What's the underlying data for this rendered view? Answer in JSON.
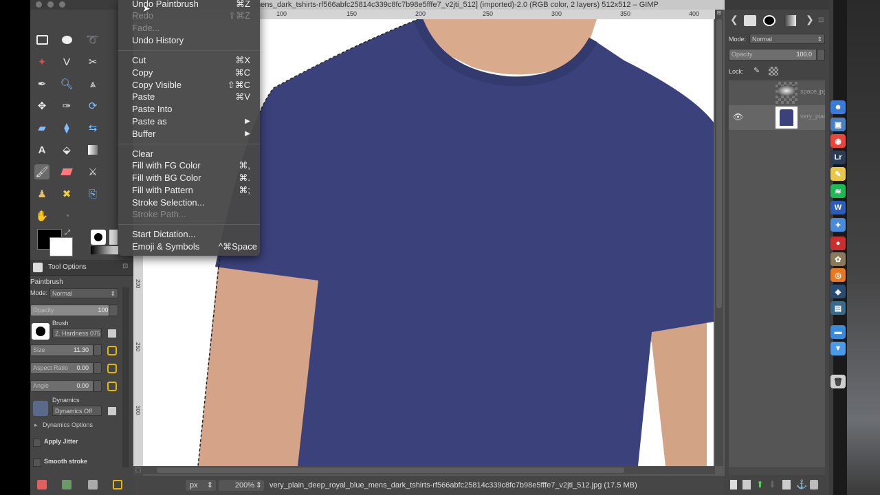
{
  "window": {
    "title": "mens_dark_tshirts-rf566abfc25814c339c8fc7b98e5fffe7_v2jti_512] (imported)-2.0 (RGB color, 2 layers) 512x512 – GIMP"
  },
  "ruler": {
    "h_ticks": [
      "100",
      "150",
      "200",
      "250",
      "300",
      "350",
      "400"
    ],
    "v_ticks": [
      "200",
      "250",
      "300"
    ]
  },
  "edit_menu": {
    "items": [
      {
        "label": "Undo Paintbrush",
        "shortcut": "⌘Z",
        "enabled": true
      },
      {
        "label": "Redo",
        "shortcut": "⇧⌘Z",
        "enabled": false
      },
      {
        "label": "Fade...",
        "shortcut": "",
        "enabled": false
      },
      {
        "label": "Undo History",
        "shortcut": "",
        "enabled": true
      },
      {
        "label": "Cut",
        "shortcut": "⌘X",
        "enabled": true
      },
      {
        "label": "Copy",
        "shortcut": "⌘C",
        "enabled": true
      },
      {
        "label": "Copy Visible",
        "shortcut": "⇧⌘C",
        "enabled": true
      },
      {
        "label": "Paste",
        "shortcut": "⌘V",
        "enabled": true
      },
      {
        "label": "Paste Into",
        "shortcut": "",
        "enabled": true
      },
      {
        "label": "Paste as",
        "shortcut": "▶",
        "enabled": true
      },
      {
        "label": "Buffer",
        "shortcut": "▶",
        "enabled": true
      },
      {
        "label": "Clear",
        "shortcut": "",
        "enabled": true
      },
      {
        "label": "Fill with FG Color",
        "shortcut": "⌘,",
        "enabled": true
      },
      {
        "label": "Fill with BG Color",
        "shortcut": "⌘.",
        "enabled": true
      },
      {
        "label": "Fill with Pattern",
        "shortcut": "⌘;",
        "enabled": true
      },
      {
        "label": "Stroke Selection...",
        "shortcut": "",
        "enabled": true
      },
      {
        "label": "Stroke Path...",
        "shortcut": "",
        "enabled": false
      },
      {
        "label": "Start Dictation...",
        "shortcut": "",
        "enabled": true
      },
      {
        "label": "Emoji & Symbols",
        "shortcut": "^⌘Space",
        "enabled": true
      }
    ]
  },
  "tool_options": {
    "tab_label": "Tool Options",
    "tool_name": "Paintbrush",
    "mode_label": "Mode:",
    "mode_value": "Normal",
    "opacity_label": "Opacity",
    "opacity_value": "100.0",
    "brush_label": "Brush",
    "brush_value": "2. Hardness 075",
    "size_label": "Size",
    "size_value": "11.30",
    "aspect_label": "Aspect Ratio",
    "aspect_value": "0.00",
    "angle_label": "Angle",
    "angle_value": "0.00",
    "dynamics_label": "Dynamics",
    "dynamics_value": "Dynamics Off",
    "dynamics_options_label": "Dynamics Options",
    "apply_jitter_label": "Apply Jitter",
    "smooth_stroke_label": "Smooth stroke"
  },
  "status_bar": {
    "unit": "px",
    "zoom": "200%",
    "message": "very_plain_deep_royal_blue_mens_dark_tshirts-rf566abfc25814c339c8fc7b98e5fffe7_v2jti_512.jpg (17.5 MB)"
  },
  "layers": {
    "mode_label": "Mode:",
    "mode_value": "Normal",
    "opacity_label": "Opacity",
    "opacity_value": "100.0",
    "lock_label": "Lock:",
    "items": [
      {
        "name": "space.jpg"
      },
      {
        "name": "very_plain"
      }
    ]
  },
  "dock_apps": [
    {
      "name": "finder",
      "color": "#3b7bd8",
      "glyph": "☻"
    },
    {
      "name": "preview",
      "color": "#4a7fc0",
      "glyph": "▣"
    },
    {
      "name": "chrome",
      "color": "#e8453c",
      "glyph": "◉"
    },
    {
      "name": "lightroom",
      "color": "#2a3d55",
      "glyph": "Lr"
    },
    {
      "name": "stickies",
      "color": "#e8c84a",
      "glyph": "✎"
    },
    {
      "name": "spotify",
      "color": "#1db954",
      "glyph": "≋"
    },
    {
      "name": "word",
      "color": "#2b5cb8",
      "glyph": "W"
    },
    {
      "name": "utility",
      "color": "#4a8ad8",
      "glyph": "✦"
    },
    {
      "name": "record",
      "color": "#c83030",
      "glyph": "●"
    },
    {
      "name": "gimp",
      "color": "#8a7a5a",
      "glyph": "✿"
    },
    {
      "name": "blender",
      "color": "#e87820",
      "glyph": "◎"
    },
    {
      "name": "steam",
      "color": "#2a4a70",
      "glyph": "◈"
    },
    {
      "name": "monitor",
      "color": "#3a6a8a",
      "glyph": "▤"
    },
    {
      "name": "folder",
      "color": "#3a8ad8",
      "glyph": "▬"
    },
    {
      "name": "downloads",
      "color": "#4a9ae8",
      "glyph": "▼"
    },
    {
      "name": "trash",
      "color": "#cfcfcf",
      "glyph": "🗑"
    }
  ],
  "colors": {
    "shirt": "#3b427b",
    "skin": "#d5a488",
    "menu_bg": "#484848",
    "ui_dark": "#454545"
  }
}
